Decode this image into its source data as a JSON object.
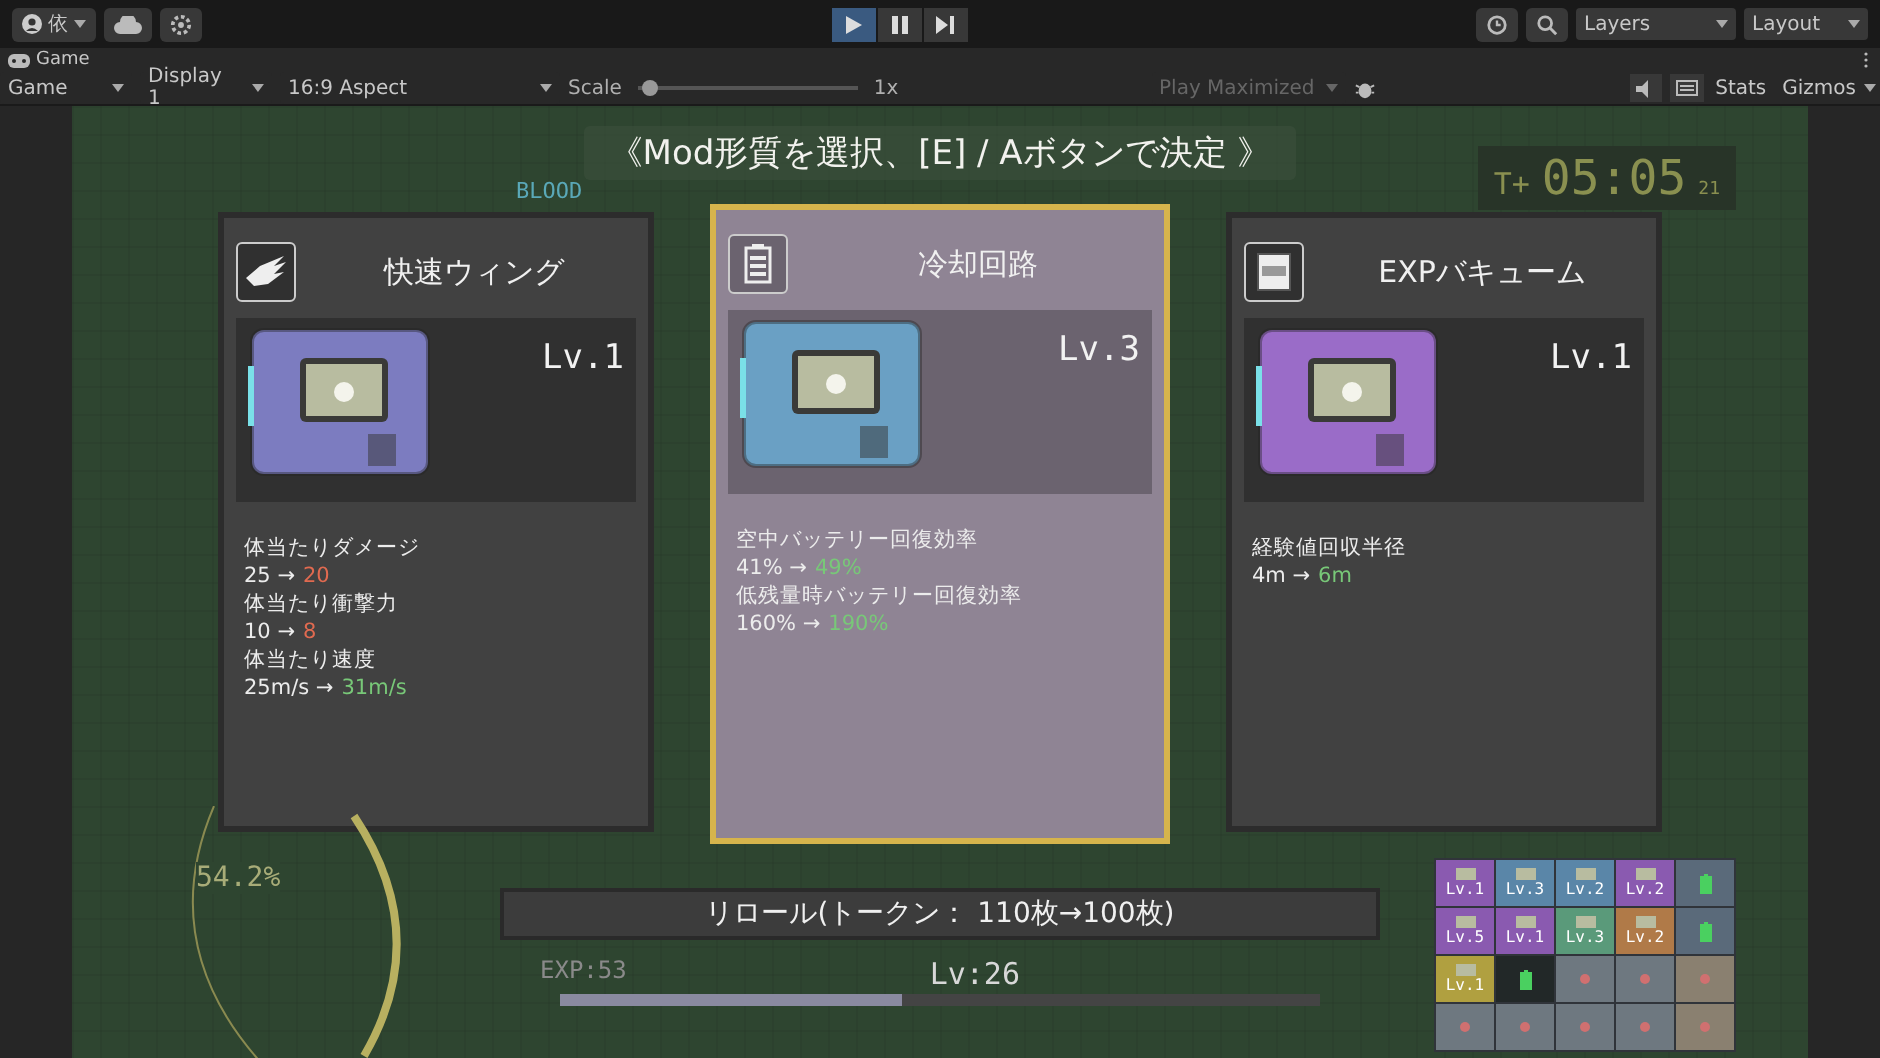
{
  "toolbar": {
    "account": "依",
    "play_controls": [
      {
        "kind": "play",
        "selected": true
      },
      {
        "kind": "pause",
        "selected": false
      },
      {
        "kind": "step",
        "selected": false
      }
    ],
    "layers": "Layers",
    "layout": "Layout"
  },
  "tab": {
    "label": "Game"
  },
  "game_toolbar": {
    "mode": "Game",
    "display": "Display 1",
    "aspect": "16:9 Aspect",
    "scale_label": "Scale",
    "scale_slider": {
      "level": 0.02
    },
    "scale": "1x",
    "play_maximized": "Play Maximized",
    "stats": "Stats",
    "gizmos": "Gizmos"
  },
  "hud": {
    "blood": "BLOOD",
    "banner": "《Mod形質を選択、[E] / Aボタンで決定 》",
    "timer_prefix": "T+",
    "timer": "05:05",
    "timer_fraction": "21",
    "gauge": "54.2%",
    "exp": "EXP:53",
    "player_level": "Lv:26",
    "exp_bar": {
      "level": 0.45
    }
  },
  "cards": [
    {
      "kind": "wing",
      "title": "快速ウィング",
      "level_text": "Lv.1",
      "color": "#7c7cc0",
      "selected": false,
      "stats": [
        {
          "label": "体当たりダメージ",
          "before": "25",
          "arrow": "→",
          "after": "20",
          "improved": false
        },
        {
          "label": "体当たり衝撃力",
          "before": "10",
          "arrow": "→",
          "after": "8",
          "improved": false
        },
        {
          "label": "体当たり速度",
          "before": "25m/s",
          "arrow": "→",
          "after": "31m/s",
          "improved": true
        }
      ]
    },
    {
      "kind": "battery",
      "title": "冷却回路",
      "level_text": "Lv.3",
      "color": "#6aa0c4",
      "selected": true,
      "stats": [
        {
          "label": "空中バッテリー回復効率",
          "before": "41%",
          "arrow": "→",
          "after": "49%",
          "improved": true
        },
        {
          "label": "低残量時バッテリー回復効率",
          "before": "160%",
          "arrow": "→",
          "after": "190%",
          "improved": true
        }
      ]
    },
    {
      "kind": "exp",
      "title": "EXPバキューム",
      "level_text": "Lv.1",
      "color": "#9a6cc8",
      "selected": false,
      "stats": [
        {
          "label": "経験値回収半径",
          "before": "4m",
          "arrow": "→",
          "after": "6m",
          "improved": true
        }
      ]
    }
  ],
  "reroll": "リロール(トークン： 110枚→100枚)",
  "inventory": [
    {
      "kind": "mod",
      "color": "#8a5ab0",
      "level_text": "Lv.1"
    },
    {
      "kind": "mod",
      "color": "#5a86a8",
      "level_text": "Lv.3"
    },
    {
      "kind": "mod",
      "color": "#5a86a8",
      "level_text": "Lv.2"
    },
    {
      "kind": "mod",
      "color": "#8a5ab0",
      "level_text": "Lv.2"
    },
    {
      "kind": "battery",
      "color": "#5a6a7a"
    },
    {
      "kind": "mod",
      "color": "#8a5ab0",
      "level_text": "Lv.5"
    },
    {
      "kind": "mod",
      "color": "#8a5ab0",
      "level_text": "Lv.1"
    },
    {
      "kind": "mod",
      "color": "#5a9a7a",
      "level_text": "Lv.3"
    },
    {
      "kind": "mod",
      "color": "#b07a48",
      "level_text": "Lv.2"
    },
    {
      "kind": "battery",
      "color": "#5a6a7a"
    },
    {
      "kind": "mod",
      "color": "#b0a040",
      "level_text": "Lv.1"
    },
    {
      "kind": "battery",
      "color": "#222828"
    },
    {
      "kind": "empty",
      "color": "#6e7880"
    },
    {
      "kind": "empty",
      "color": "#6e7880"
    },
    {
      "kind": "empty",
      "color": "#8a8070"
    },
    {
      "kind": "empty",
      "color": "#6e7880"
    },
    {
      "kind": "empty",
      "color": "#6e7880"
    },
    {
      "kind": "empty",
      "color": "#6e7880"
    },
    {
      "kind": "empty",
      "color": "#6e7880"
    },
    {
      "kind": "empty",
      "color": "#8a8070"
    }
  ]
}
